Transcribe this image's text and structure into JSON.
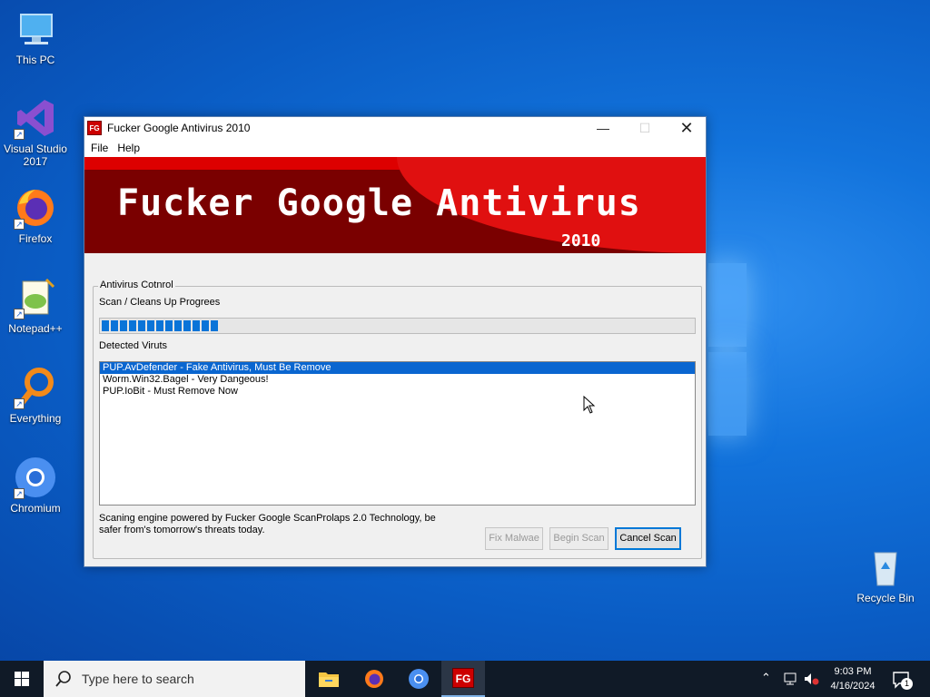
{
  "desktop": {
    "icons": [
      {
        "label": "This PC"
      },
      {
        "label": "Visual Studio 2017"
      },
      {
        "label": "Firefox"
      },
      {
        "label": "Notepad++"
      },
      {
        "label": "Everything"
      },
      {
        "label": "Chromium"
      },
      {
        "label": "Recycle Bin"
      }
    ]
  },
  "window": {
    "title": "Fucker Google Antivirus 2010",
    "icon_text": "FG",
    "menu": [
      "File",
      "Help"
    ],
    "banner_title": "Fucker Google Antivirus",
    "banner_year": "2010",
    "group_label": "Antivirus Cotnrol",
    "progress_label": "Scan / Cleans Up Progrees",
    "progress_fraction": 0.2,
    "detected_label": "Detected Viruts",
    "detections": [
      "PUP.AvDefender - Fake Antivirus, Must Be Remove",
      "Worm.Win32.Bagel - Very Dangeous!",
      "PUP.IoBit - Must Remove Now"
    ],
    "footer": "Scaning engine powered by Fucker Google ScanProlaps 2.0 Technology, be safer from's tomorrow's threats today.",
    "buttons": {
      "fix": "Fix Malwae",
      "begin": "Begin Scan",
      "cancel": "Cancel Scan"
    }
  },
  "taskbar": {
    "search_placeholder": "Type here to search",
    "time": "9:03 PM",
    "date": "4/16/2024",
    "notifications": "1",
    "fg_label": "FG"
  },
  "colors": {
    "banner_dark": "#7a0000",
    "banner_red": "#e01010",
    "selection": "#0a66d0",
    "progress": "#0a74d8"
  }
}
